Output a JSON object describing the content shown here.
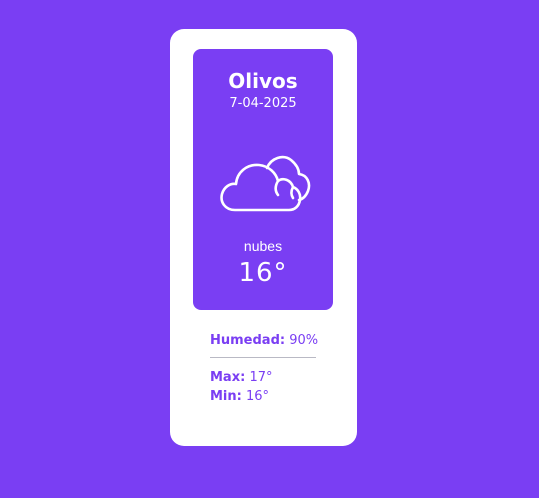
{
  "weather": {
    "city": "Olivos",
    "date": "7-04-2025",
    "icon": "cloud-icon",
    "description": "nubes",
    "temperature": "16°"
  },
  "details": {
    "humidity_label": "Humedad:",
    "humidity_value": "90%",
    "max_label": "Max:",
    "max_value": "17°",
    "min_label": "Min:",
    "min_value": "16°"
  },
  "colors": {
    "background": "#7a3ef3",
    "card": "#ffffff",
    "accent": "#7a3ef3"
  }
}
